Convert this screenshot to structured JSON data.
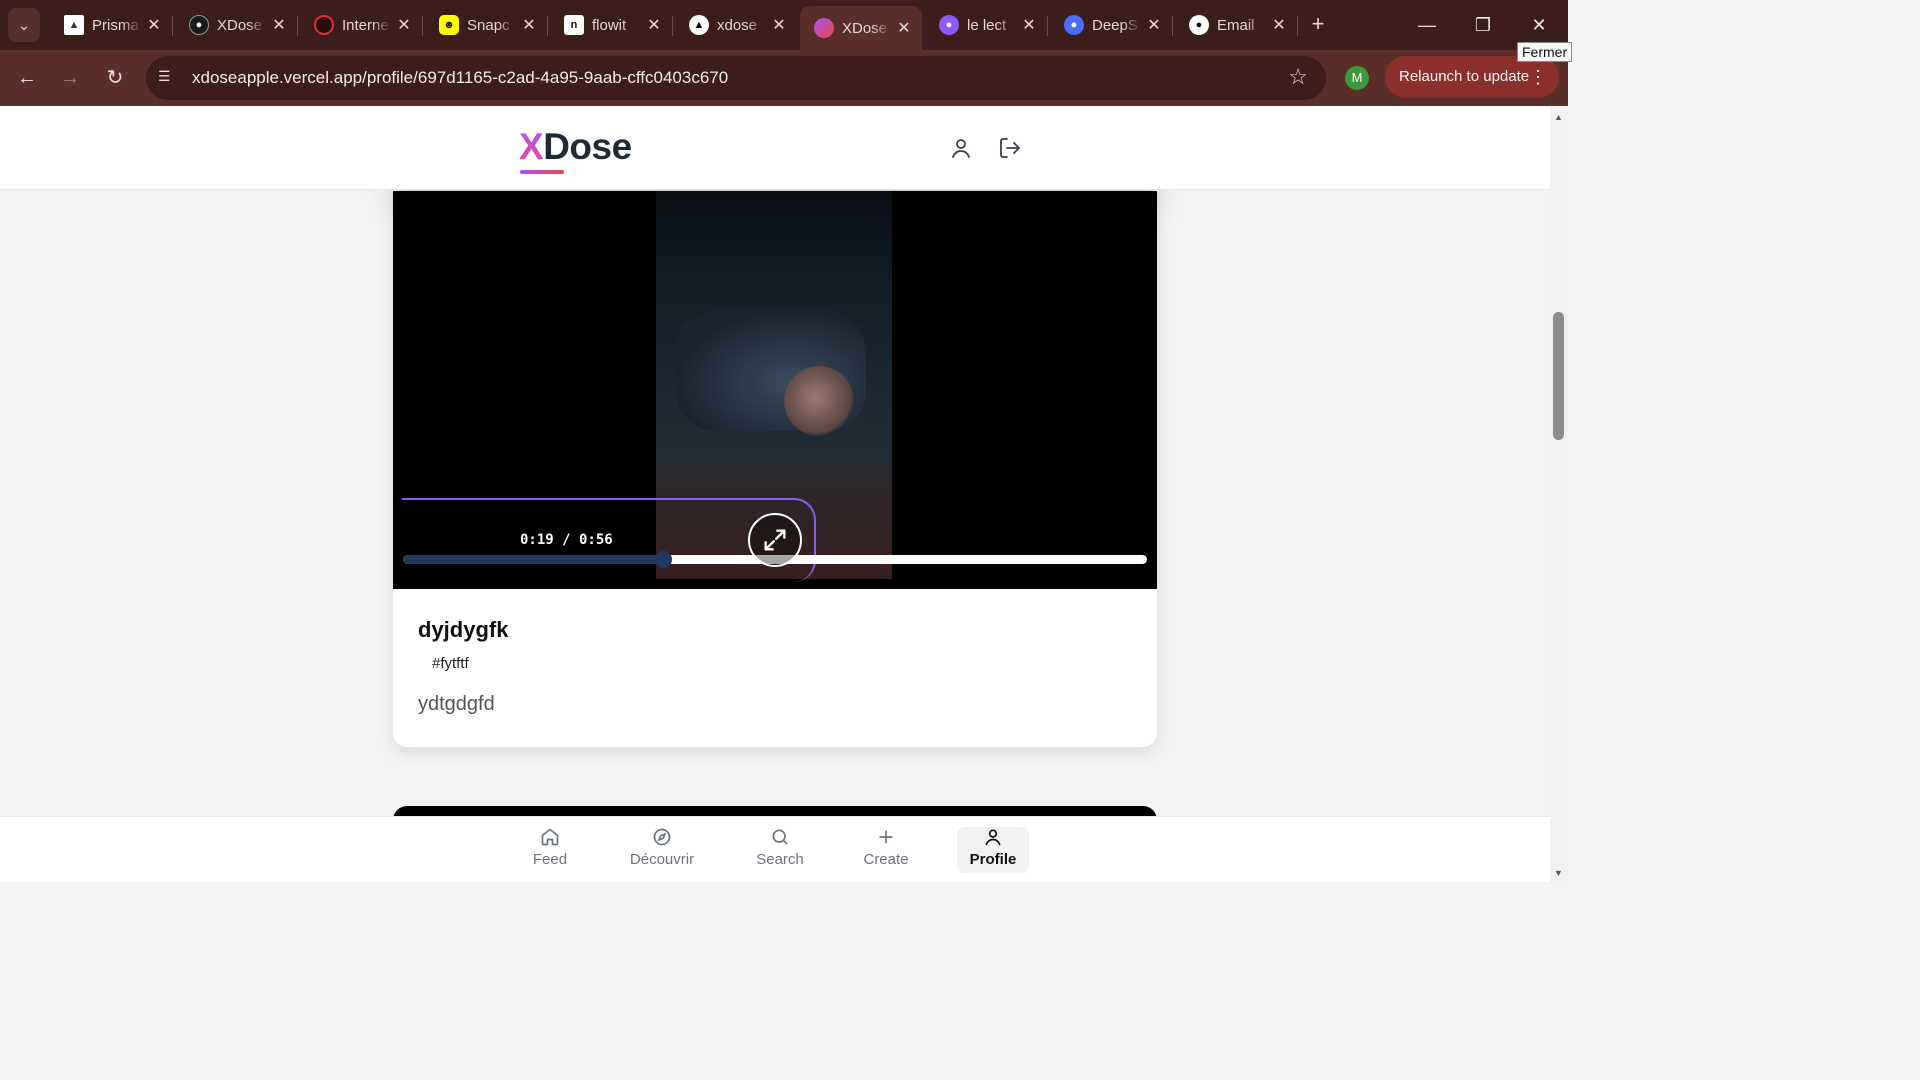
{
  "browser": {
    "tabs": [
      {
        "title": "Prisma",
        "icon": "prisma-icon",
        "color": "#e6d9d6"
      },
      {
        "title": "XDose",
        "icon": "github-icon",
        "color": "#e6d9d6"
      },
      {
        "title": "Interne",
        "icon": "gauge-icon",
        "color": "#d33"
      },
      {
        "title": "Snapc",
        "icon": "snapchat-icon",
        "color": "#fffc00"
      },
      {
        "title": "flowit",
        "icon": "notion-icon",
        "color": "#fff"
      },
      {
        "title": "xdose",
        "icon": "vercel-icon",
        "color": "#fff"
      },
      {
        "title": "XDose",
        "icon": "xdose-flame-icon",
        "color": "#ef4444",
        "active": true
      },
      {
        "title": "le lect",
        "icon": "octopus-icon",
        "color": "#8b5cf6"
      },
      {
        "title": "DeepS",
        "icon": "deepseek-icon",
        "color": "#4d6bfe"
      },
      {
        "title": "Email",
        "icon": "github-icon",
        "color": "#fff"
      }
    ],
    "url": "xdoseapple.vercel.app/profile/697d1165-c2ad-4a95-9aab-cffc0403c670",
    "profile_initial": "M",
    "relaunch_label": "Relaunch to update",
    "tooltip": "Fermer"
  },
  "app": {
    "logo_x": "X",
    "logo_rest": "Dose",
    "brand_gradient": [
      "#a855f7",
      "#ec4899"
    ]
  },
  "post": {
    "video": {
      "time_label": "0:19 / 0:56",
      "progress": 0.35,
      "accent": "#8b5cf6",
      "fill_color": "#1e3a5f"
    },
    "title": "dyjdygfk",
    "tag": "#fytftf",
    "description": "ydtgdgfd"
  },
  "bottom_nav": [
    {
      "label": "Feed",
      "icon": "home-icon"
    },
    {
      "label": "Découvrir",
      "icon": "compass-icon"
    },
    {
      "label": "Search",
      "icon": "search-icon"
    },
    {
      "label": "Create",
      "icon": "plus-icon"
    },
    {
      "label": "Profile",
      "icon": "user-icon",
      "active": true
    }
  ]
}
